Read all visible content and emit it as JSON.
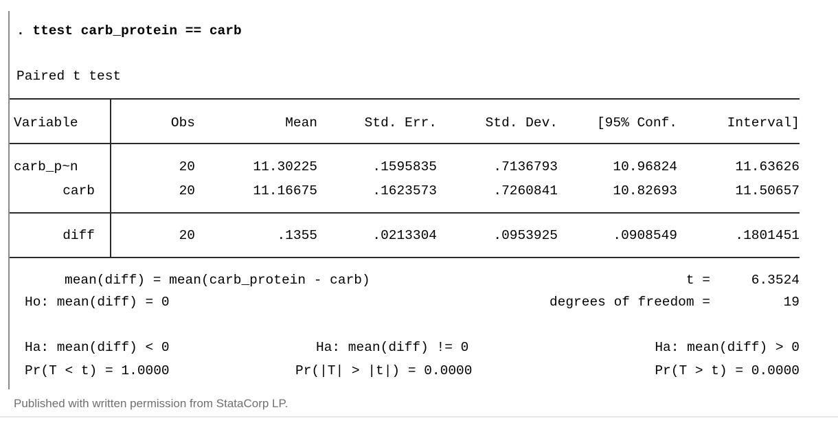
{
  "command": ". ttest carb_protein == carb",
  "test_title": "Paired t test",
  "table": {
    "headers": [
      "Variable",
      "Obs",
      "Mean",
      "Std. Err.",
      "Std. Dev.",
      "[95% Conf.",
      "Interval]"
    ],
    "rows": [
      [
        "carb_p~n",
        "20",
        "11.30225",
        ".1595835",
        ".7136793",
        "10.96824",
        "11.63626"
      ],
      [
        "carb",
        "20",
        "11.16675",
        ".1623573",
        ".7260841",
        "10.82693",
        "11.50657"
      ]
    ],
    "diff_row": [
      "diff",
      "20",
      ".1355",
      ".0213304",
      ".0953925",
      ".0908549",
      ".1801451"
    ]
  },
  "summary": {
    "mean_def": "mean(diff) = mean(carb_protein - carb)",
    "t_label": "t =",
    "t_value": "6.3524",
    "ho": "Ho: mean(diff) = 0",
    "df_label": "degrees of freedom =",
    "df_value": "19",
    "ha_lt": "Ha: mean(diff) < 0",
    "ha_ne": "Ha: mean(diff) != 0",
    "ha_gt": "Ha: mean(diff) > 0",
    "p_lt": "Pr(T < t) = 1.0000",
    "p_ne": "Pr(|T| > |t|) = 0.0000",
    "p_gt": "Pr(T > t) = 0.0000"
  },
  "caption": "Published with written permission from StataCorp LP."
}
